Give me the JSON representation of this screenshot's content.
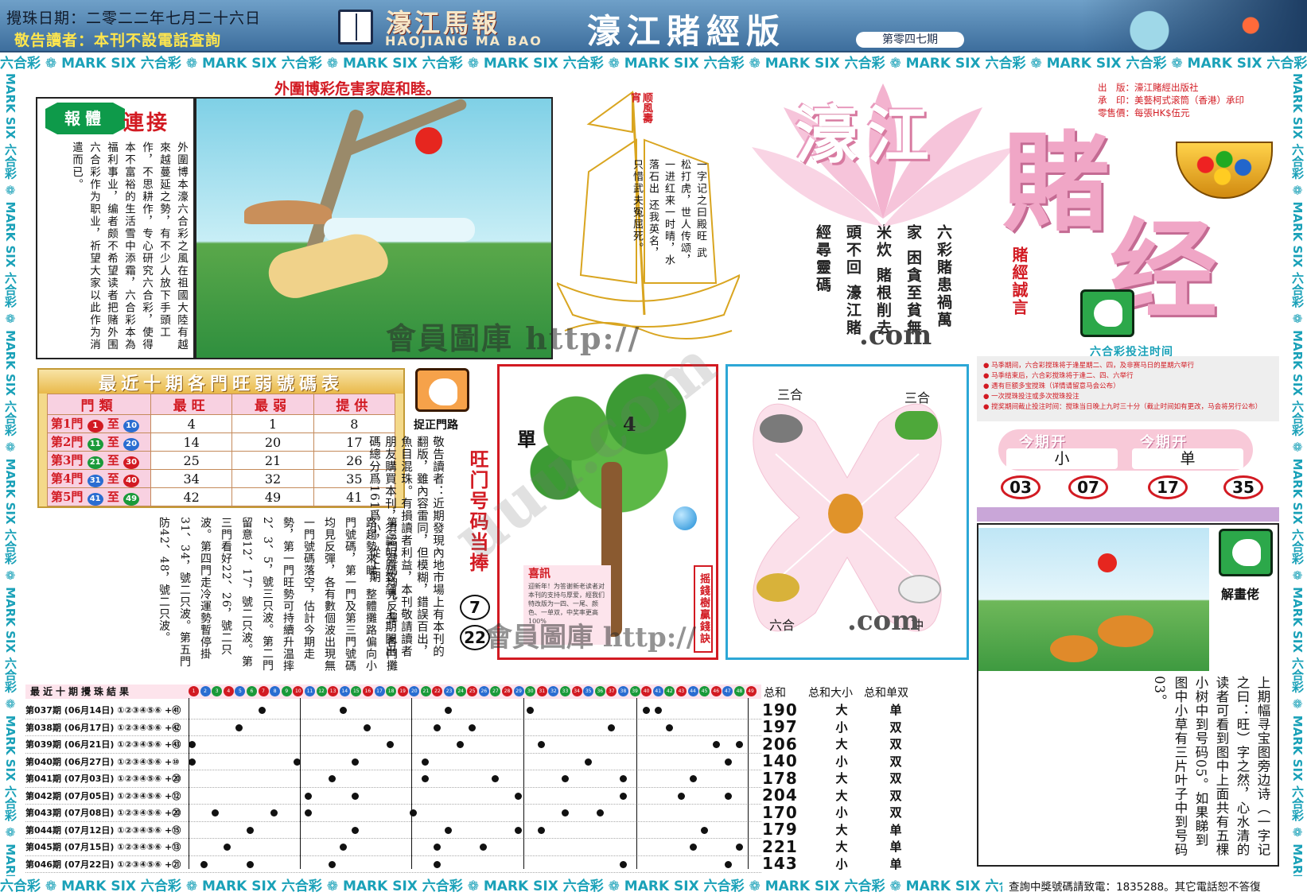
{
  "header": {
    "draw_date": "攪珠日期：二零二二年七月二十六日",
    "reader_notice": "敬告讀者：本刊不設電話查詢",
    "masthead_cn": "濠江馬報",
    "masthead_en": "HAOJIANG MA BAO",
    "edition_title": "濠江賭經版",
    "issue_no": "第零四七期"
  },
  "bands": {
    "text": "六合彩 ❁ MARK SIX 六合彩 ❁ MARK SIX 六合彩 ❁ MARK SIX 六合彩 ❁ MARK SIX 六合彩 ❁ MARK SIX 六合彩 ❁ MARK SIX 六合彩 ❁ MARK SIX 六合彩 ❁ MARK SIX 六合彩 ❁ MARK SIX 六合彩 ❁ MARK SIX 六合彩 ❁ MARK SIX",
    "side_text": "MARK SIX 六合彩 ❁ MARK SIX 六合彩 ❁ MARK SIX 六合彩 ❁ MARK SIX 六合彩 ❁ MARK SIX 六合彩 ❁ MARK SIX 六合彩 ❁ MARK SIX 六合彩 ❁ MARK SIX 六合彩 ❁"
  },
  "article": {
    "headline": "外圍博彩危害家庭和睦。",
    "tag_baoti": "報體",
    "tag_lianjie": "連接",
    "body": "外圍博本濠六合彩之風在祖國大陸有越來越蔓延之勢，有不少人放下手頭工作，不思耕作，专心研究六合彩，使得本不富裕的生活雪中添霜，六合彩本為福利事业，编者颇不希望读者把赌外围六合彩作为职业，祈望大家以此作为消遣而已。"
  },
  "boat": {
    "flag": "顺風壽宵",
    "poem": "一字记之曰殿旺 武松打虎，世人传颂，一进红来一时晴，水落石出 还我英名，只惜武夫冤屈死。"
  },
  "maxims": {
    "text": "六彩賭患禍萬家 困貪至貧無米炊 賭根削去頭不回 濠江賭經尋靈碼"
  },
  "watermarks": {
    "w1": "會員圖庫 http://",
    "w2": "會員圖庫 http://",
    "dotcom": ".com",
    "diag": "uuu.com"
  },
  "title": {
    "haojiang": "濠江",
    "du": "賭",
    "jing": "经",
    "chengyan": "賭經誠言"
  },
  "publisher": {
    "line1": "出　版：濠江賭經出版社",
    "line2": "承　印：美藝柯式滚筒（香港）承印",
    "line3": "零售價：每張HK$伍元"
  },
  "bet_time": {
    "title": "六合彩投注时间",
    "notes": [
      "● 马季期间，六合彩搅珠将于逢星期二、四，及非赛马日的星期六举行",
      "● 马季结束后，六合彩搅珠将于逢二、四、六举行",
      "● 遇有巨额多宝搅珠（详情请留意马会公布）",
      "● 一次搅珠投注或多次搅珠投注",
      "● 搅奖期间截止投注时间：搅珠当日晚上九时三十分（截止时间如有更改，马会将另行公布）"
    ]
  },
  "current_issue": {
    "head1": "今期开",
    "head2": "今期开",
    "val1": "小",
    "val2": "单",
    "balls": [
      "03",
      "07",
      "17",
      "35"
    ]
  },
  "stats": {
    "title": "最近十期各門旺弱號碼表",
    "headers": [
      "門類",
      "最旺",
      "最弱",
      "提供"
    ],
    "rows": [
      {
        "door": "第1門",
        "from": "1",
        "to": "10",
        "hot": "4",
        "weak": "1",
        "tip": "8",
        "c1": "m-red",
        "c2": "m-blue"
      },
      {
        "door": "第2門",
        "from": "11",
        "to": "20",
        "hot": "14",
        "weak": "20",
        "tip": "17",
        "c1": "m-green",
        "c2": "m-blue"
      },
      {
        "door": "第3門",
        "from": "21",
        "to": "30",
        "hot": "25",
        "weak": "21",
        "tip": "26",
        "c1": "m-green",
        "c2": "m-red"
      },
      {
        "door": "第4門",
        "from": "31",
        "to": "40",
        "hot": "34",
        "weak": "32",
        "tip": "35",
        "c1": "m-blue",
        "c2": "m-red"
      },
      {
        "door": "第5門",
        "from": "41",
        "to": "49",
        "hot": "42",
        "weak": "49",
        "tip": "41",
        "c1": "m-blue",
        "c2": "m-green"
      }
    ]
  },
  "mid_article": {
    "body": "第三門號碼均見反彈，各門攤路趨勢來睇，整體攤路偏向小門號碼，第一門及第三門號碼均見反彈，各有數個波出現無一門號碼落空，估計今期走勢，第一門旺勢可持續升温摔2、3、5，號三只波。第二門留意12、17，號二只波。第三門看好22、26，號二只波。第四門走冷運勢暫停掛31、34，號二只波。第五門防42、48，號二只波。"
  },
  "notice": {
    "label": "捉正門路",
    "body": "敬告讀者：近期發現內地市場上有本刊的翻版，雖內容雷同，但模糊，錯誤百出，魚目混珠。有損讀者利益，本刊敬請讀者朋友購買本刊，須認明原致謹。上期開出碼總分爲161爲小，從上期",
    "wangmen": "旺门号码当捧",
    "n1": "7",
    "n2": "22"
  },
  "tree": {
    "dan": "單",
    "four": "4",
    "xixun_title": "喜訊",
    "xixun_body": "迎新年！为答谢新老读者对本刊的支持与厚爱，經我们特改版为一四、一尾、颜色、一单双，中奖率更高100%",
    "vlabel": "摇錢樹贏錢訣"
  },
  "zodiac": {
    "sanhe_left": "三合",
    "sanhe_right": "三合",
    "liuhe": "六合",
    "chong": "冲"
  },
  "riddle": {
    "label": "解畫佬",
    "body": "上期幅寻宝图旁边诗（一字记之曰：旺）字之然，心水清的读者可看到图中上面共有五棵小树中到号码05。如果睇到图中小草有三片叶子中到号码03。"
  },
  "results": {
    "head": "最近十期攪珠結果",
    "rows": [
      {
        "label": "第037期 (06月14日) ①②③④⑤⑥ +㊶",
        "dots": [
          7,
          14,
          23,
          30,
          40,
          41
        ],
        "sum": "190",
        "size": "大",
        "odd": "单"
      },
      {
        "label": "第038期 (06月17日) ①②③④⑤⑥ +㊷",
        "dots": [
          5,
          16,
          22,
          25,
          37,
          42
        ],
        "sum": "197",
        "size": "小",
        "odd": "双"
      },
      {
        "label": "第039期 (06月21日) ①②③④⑤⑥ +㊸",
        "dots": [
          1,
          18,
          24,
          31,
          46,
          48
        ],
        "sum": "206",
        "size": "大",
        "odd": "双"
      },
      {
        "label": "第040期 (06月27日) ①②③④⑤⑥ +⑩",
        "dots": [
          1,
          10,
          15,
          21,
          35,
          47
        ],
        "sum": "140",
        "size": "小",
        "odd": "双"
      },
      {
        "label": "第041期 (07月03日) ①②③④⑤⑥ +⑳",
        "dots": [
          13,
          21,
          27,
          33,
          38,
          44
        ],
        "sum": "178",
        "size": "大",
        "odd": "双"
      },
      {
        "label": "第042期 (07月05日) ①②③④⑤⑥ +⑫",
        "dots": [
          11,
          15,
          29,
          38,
          43,
          47
        ],
        "sum": "204",
        "size": "大",
        "odd": "双"
      },
      {
        "label": "第043期 (07月08日) ①②③④⑤⑥ +⑳",
        "dots": [
          3,
          8,
          11,
          20,
          33,
          36
        ],
        "sum": "170",
        "size": "小",
        "odd": "双"
      },
      {
        "label": "第044期 (07月12日) ①②③④⑤⑥ +⑮",
        "dots": [
          6,
          15,
          23,
          29,
          31,
          45
        ],
        "sum": "179",
        "size": "大",
        "odd": "单"
      },
      {
        "label": "第045期 (07月15日) ①②③④⑤⑥ +⑬",
        "dots": [
          4,
          14,
          22,
          26,
          44,
          48
        ],
        "sum": "221",
        "size": "大",
        "odd": "单"
      },
      {
        "label": "第046期 (07月22日) ①②③④⑤⑥ +㉑",
        "dots": [
          2,
          6,
          13,
          22,
          38,
          47
        ],
        "sum": "143",
        "size": "小",
        "odd": "单"
      }
    ],
    "sum_head": "总和　　总和大小　总和单双"
  },
  "query_line": "查詢中獎號碼請致電：1835288。其它電話恕不答復",
  "colors": {
    "accent_red": "#d21a22",
    "band_teal": "#1aa1b8",
    "pink": "#f0a6c6"
  }
}
